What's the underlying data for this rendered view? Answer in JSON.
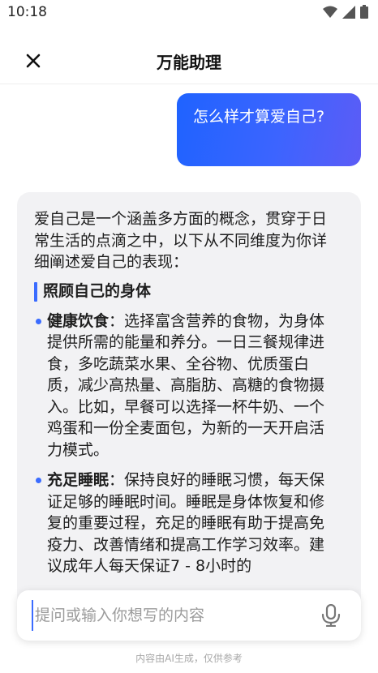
{
  "status_bar": {
    "time": "10:18",
    "icons": [
      "wifi-icon",
      "signal-icon",
      "battery-icon"
    ]
  },
  "header": {
    "title": "万能助理",
    "close_icon": "close-icon"
  },
  "user_message": {
    "text": "怎么样才算爱自己?"
  },
  "answer": {
    "intro": "爱自己是一个涵盖多方面的概念，贯穿于日常生活的点滴之中，以下从不同维度为你详细阐述爱自己的表现：",
    "section_title": "照顾自己的身体",
    "items": [
      {
        "title": "健康饮食",
        "text": "：选择富含营养的食物，为身体提供所需的能量和养分。一日三餐规律进食，多吃蔬菜水果、全谷物、优质蛋白质，减少高热量、高脂肪、高糖的食物摄入。比如，早餐可以选择一杯牛奶、一个鸡蛋和一份全麦面包，为新的一天开启活力模式。"
      },
      {
        "title": "充足睡眠",
        "text": "：保持良好的睡眠习惯，每天保证足够的睡眠时间。睡眠是身体恢复和修复的重要过程，充足的睡眠有助于提高免疫力、改善情绪和提高工作学习效率。建议成年人每天保证7 - 8小时的"
      }
    ]
  },
  "input": {
    "placeholder": "提问或输入你想写的内容",
    "value": "",
    "mic_icon": "microphone-icon"
  },
  "footer": {
    "disclaimer": "内容由AI生成，仅供参考"
  },
  "colors": {
    "accent": "#3b6cff",
    "bubble_start": "#1f63ff",
    "bubble_end": "#5c5cf6",
    "card_bg": "#f2f2f4"
  }
}
